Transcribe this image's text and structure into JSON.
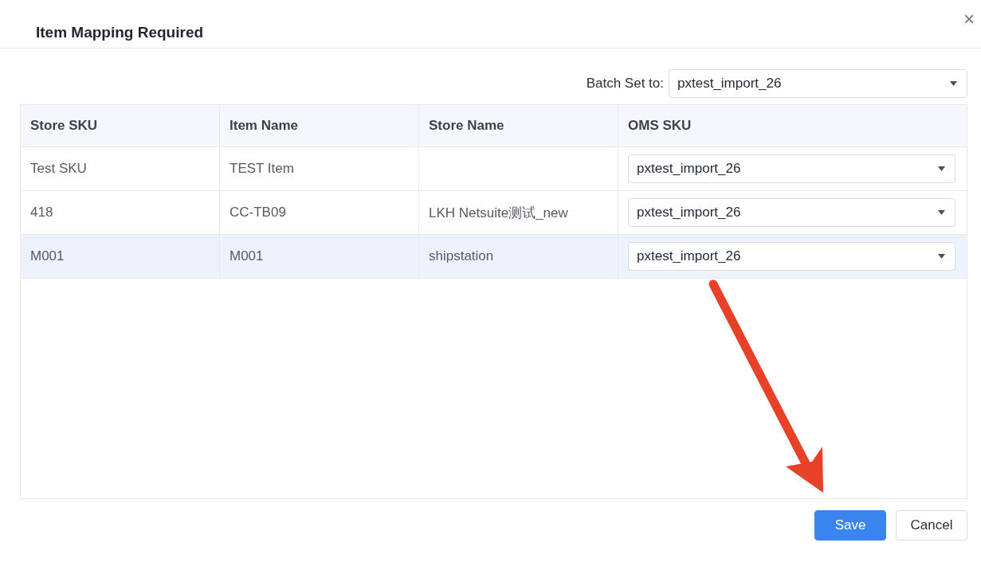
{
  "dialog": {
    "title": "Item Mapping Required",
    "close_icon": "×"
  },
  "batch_set": {
    "label": "Batch Set to:",
    "value": "pxtest_import_26"
  },
  "table": {
    "columns": [
      "Store SKU",
      "Item Name",
      "Store Name",
      "OMS SKU"
    ],
    "rows": [
      {
        "store_sku": "Test SKU",
        "item_name": "TEST Item",
        "store_name": "",
        "oms_sku": "pxtest_import_26",
        "selected": false
      },
      {
        "store_sku": "418",
        "item_name": "CC-TB09",
        "store_name": "LKH Netsuite测试_new",
        "oms_sku": "pxtest_import_26",
        "selected": false
      },
      {
        "store_sku": "M001",
        "item_name": "M001",
        "store_name": "shipstation",
        "oms_sku": "pxtest_import_26",
        "selected": true
      }
    ]
  },
  "buttons": [
    {
      "label": "Save",
      "kind": "primary"
    },
    {
      "label": "Cancel",
      "kind": "default"
    }
  ]
}
